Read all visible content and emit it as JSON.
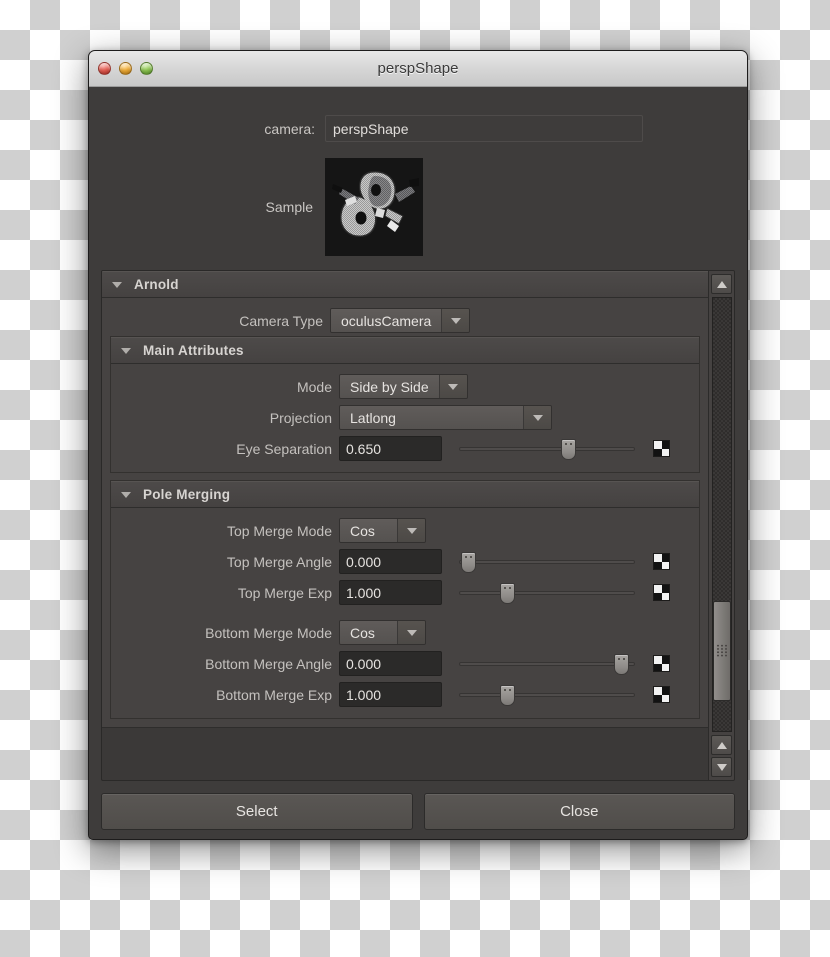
{
  "window": {
    "title": "perspShape",
    "traffic_lights": [
      "close-button",
      "minimize-button",
      "zoom-button"
    ]
  },
  "camera": {
    "label": "camera:",
    "value": "perspShape"
  },
  "sample": {
    "label": "Sample"
  },
  "arnold": {
    "title": "Arnold",
    "camera_type": {
      "label": "Camera Type",
      "value": "oculusCamera"
    },
    "main_attributes": {
      "title": "Main Attributes",
      "rows": [
        {
          "label": "Mode",
          "value": "Side by Side",
          "kind": "dropdown"
        },
        {
          "label": "Projection",
          "value": "Latlong",
          "kind": "dropdown-wide"
        },
        {
          "label": "Eye Separation",
          "value": "0.650",
          "kind": "slider",
          "slider_pct": 62
        }
      ]
    },
    "pole_merging": {
      "title": "Pole Merging",
      "rows": [
        {
          "label": "Top Merge Mode",
          "value": "Cos",
          "kind": "dropdown"
        },
        {
          "label": "Top Merge Angle",
          "value": "0.000",
          "kind": "slider",
          "slider_pct": 5
        },
        {
          "label": "Top Merge Exp",
          "value": "1.000",
          "kind": "slider",
          "slider_pct": 27
        },
        {
          "label": "Bottom Merge Mode",
          "value": "Cos",
          "kind": "dropdown"
        },
        {
          "label": "Bottom Merge Angle",
          "value": "0.000",
          "kind": "slider",
          "slider_pct": 92
        },
        {
          "label": "Bottom Merge Exp",
          "value": "1.000",
          "kind": "slider",
          "slider_pct": 27
        }
      ]
    }
  },
  "footer": {
    "select_label": "Select",
    "close_label": "Close"
  },
  "colors": {
    "dialog_bg": "#3e3c3b",
    "panel_bg": "#464342",
    "header_bg": "#4a4746",
    "field_bg": "#2b2a29",
    "text": "#c9c6c3",
    "titlebar": "#d6d6d6"
  }
}
